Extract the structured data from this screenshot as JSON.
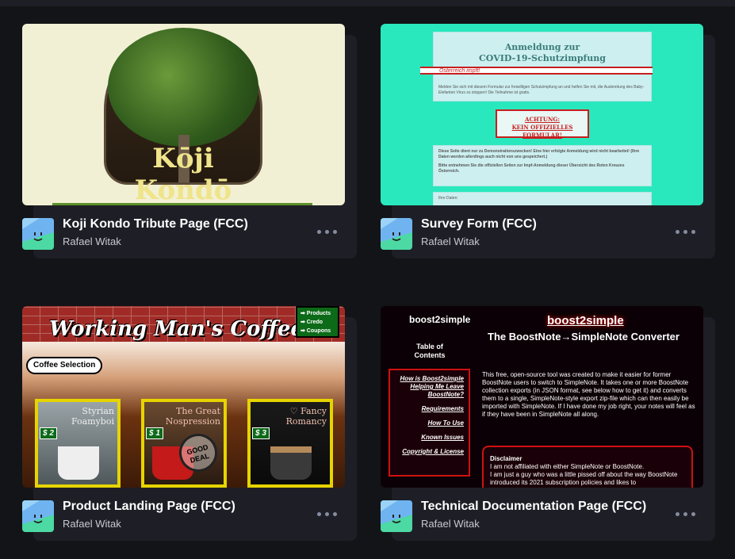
{
  "cards": [
    {
      "title": "Koji Kondo Tribute Page (FCC)",
      "author": "Rafael Witak",
      "thumb_text": {
        "logo": "Kōji Kondō"
      }
    },
    {
      "title": "Survey Form (FCC)",
      "author": "Rafael Witak",
      "thumb_text": {
        "heading1": "Anmeldung zur",
        "heading2": "COVID-19-Schutzimpfung",
        "stripe": "Österreich impft!",
        "intro": "Melden Sie sich mit diesem Formular zur freiwilligen Schutzimpfung an und helfen Sie mit, die Ausbreitung des Baby-Elefanten Virus zu stoppen! Die Teilnahme ist gratis.",
        "warn1": "ACHTUNG:",
        "warn2": "KEIN OFFIZIELLES FORMULAR!",
        "notice": "Diese Seite dient nur zu Demonstrationszwecken! Eine hier erfolgte Anmeldung wird nicht bearbeitet! (Ihre Daten werden allerdings auch nicht von uns gespeichert.)",
        "notice2": "Bitte entnehmen Sie die offiziellen Seiten zur Impf-Anmeldung dieser Übersicht des Roten Kreuzes Österreich.",
        "data_label": "Ihre Daten:"
      }
    },
    {
      "title": "Product Landing Page (FCC)",
      "author": "Rafael Witak",
      "thumb_text": {
        "logo": "Working Man's Coffee",
        "nav": [
          "➡ Products",
          "➡ Credo",
          "➡ Coupons"
        ],
        "pill": "Coffee Selection",
        "products": [
          {
            "name": "Styrian Foamyboi",
            "price": "$ 2"
          },
          {
            "name": "The Great Nospression",
            "price": "$ 1",
            "stamp": "GOOD DEAL"
          },
          {
            "name": "♡ Fancy Romancy",
            "price": "$ 3"
          }
        ]
      }
    },
    {
      "title": "Technical Documentation Page (FCC)",
      "author": "Rafael Witak",
      "thumb_text": {
        "brand": "boost2simple",
        "h1": "boost2simple",
        "h2": "The BoostNote→SimpleNote Converter",
        "toc_heading": "Table of Contents",
        "toc": [
          "How is Boost2simple Helping Me Leave BoostNote?",
          "Requirements",
          "How To Use",
          "Known Issues",
          "Copyright & License"
        ],
        "intro": "This free, open-source tool was created to make it easier for former BoostNote users to switch to SimpleNote. It takes one or more BoostNote collection exports (in JSON format, see below how to get it) and converts them to a single, SimpleNote-style export zip-file which can then easily be imported with SimpleNote. If I have done my job right, your notes will feel as if they have been in SimpleNote all along.",
        "disc_heading": "Disclaimer",
        "disc1": "I am not affiliated with either SimpleNote or BoostNote.",
        "disc2": "I am just a guy who was a little pissed off about the way BoostNote introduced its 2021 subscription policies and likes to"
      }
    }
  ],
  "colors": {
    "background": "#131417",
    "card": "#1e1f26",
    "title": "#ffffff",
    "author": "#c7c9d3",
    "more": "#868ca0"
  },
  "icons": {
    "more": "more-dots-icon",
    "avatar": "user-avatar-icon"
  }
}
